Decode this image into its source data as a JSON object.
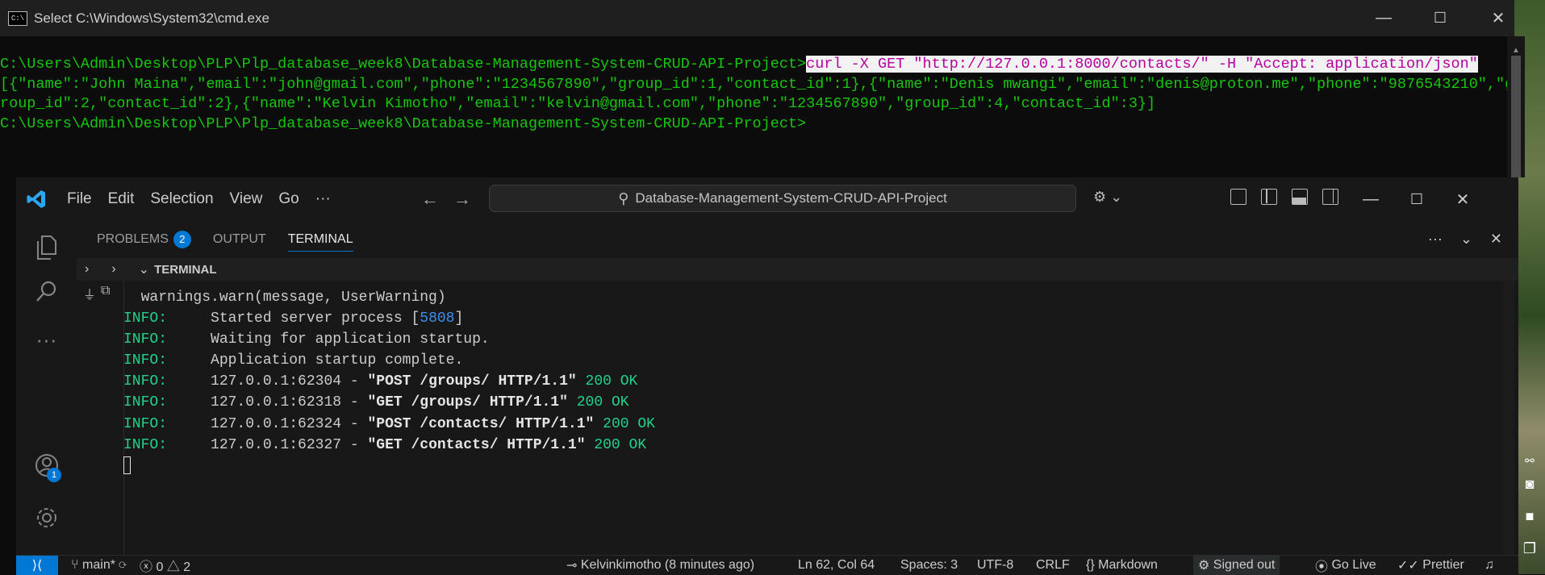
{
  "cmd": {
    "title": "Select C:\\Windows\\System32\\cmd.exe",
    "prompt": "C:\\Users\\Admin\\Desktop\\PLP\\Plp_database_week8\\Database-Management-System-CRUD-API-Project>",
    "command": "curl -X GET \"http://127.0.0.1:8000/contacts/\" -H \"Accept: application/json\"",
    "output_line1": "[{\"name\":\"John Maina\",\"email\":\"john@gmail.com\",\"phone\":\"1234567890\",\"group_id\":1,\"contact_id\":1},{\"name\":\"Denis mwangi\",\"email\":\"denis@proton.me\",\"phone\":\"9876543210\",\"g",
    "output_line2": "roup_id\":2,\"contact_id\":2},{\"name\":\"Kelvin Kimotho\",\"email\":\"kelvin@gmail.com\",\"phone\":\"1234567890\",\"group_id\":4,\"contact_id\":3}]",
    "prompt2": "C:\\Users\\Admin\\Desktop\\PLP\\Plp_database_week8\\Database-Management-System-CRUD-API-Project>",
    "minimize": "—",
    "maximize": "☐",
    "close": "✕"
  },
  "vscode": {
    "menu": [
      "File",
      "Edit",
      "Selection",
      "View",
      "Go",
      "···"
    ],
    "search_text": "Database-Management-System-CRUD-API-Project",
    "window": {
      "minimize": "—",
      "maximize": "☐",
      "close": "✕"
    },
    "activity": {
      "accounts_badge": "1"
    },
    "panel": {
      "tabs": [
        {
          "label": "PROBLEMS",
          "badge": "2"
        },
        {
          "label": "OUTPUT"
        },
        {
          "label": "TERMINAL"
        }
      ],
      "subhead": "TERMINAL"
    },
    "terminal": {
      "line0": "  warnings.warn(message, UserWarning)",
      "info": "INFO:",
      "l1_text": "Started server process [",
      "l1_pid": "5808",
      "l1_end": "]",
      "l2_text": "Waiting for application startup.",
      "l3_text": "Application startup complete.",
      "r1_addr": "127.0.0.1:62304 - ",
      "r1_req": "\"POST /groups/ HTTP/1.1\"",
      "r2_addr": "127.0.0.1:62318 - ",
      "r2_req": "\"GET /groups/ HTTP/1.1\"",
      "r3_addr": "127.0.0.1:62324 - ",
      "r3_req": "\"POST /contacts/ HTTP/1.1\"",
      "r4_addr": "127.0.0.1:62327 - ",
      "r4_req": "\"GET /contacts/ HTTP/1.1\"",
      "status": "200 OK"
    },
    "statusbar": {
      "branch": "main*",
      "errors": "0",
      "warnings": "2",
      "blame": "Kelvinkimotho (8 minutes ago)",
      "position": "Ln 62, Col 64",
      "spaces": "Spaces: 3",
      "encoding": "UTF-8",
      "eol": "CRLF",
      "language": "Markdown",
      "signed": "Signed out",
      "golive": "Go Live",
      "prettier": "Prettier"
    }
  }
}
